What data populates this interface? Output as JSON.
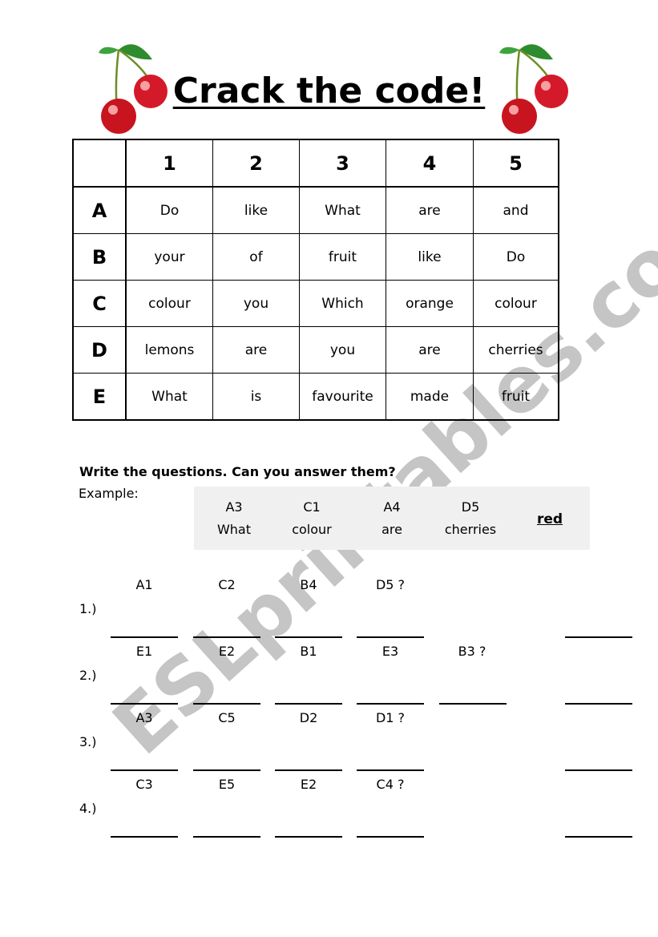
{
  "title": "Crack the code!",
  "watermark": "ESLprintables.com",
  "grid": {
    "columns": [
      "1",
      "2",
      "3",
      "4",
      "5"
    ],
    "rows": [
      {
        "label": "A",
        "cells": [
          "Do",
          "like",
          "What",
          "are",
          "and"
        ]
      },
      {
        "label": "B",
        "cells": [
          "your",
          "of",
          "fruit",
          "like",
          "Do"
        ]
      },
      {
        "label": "C",
        "cells": [
          "colour",
          "you",
          "Which",
          "orange",
          "colour"
        ]
      },
      {
        "label": "D",
        "cells": [
          "lemons",
          "are",
          "you",
          "are",
          "cherries"
        ]
      },
      {
        "label": "E",
        "cells": [
          "What",
          "is",
          "favourite",
          "made",
          "fruit"
        ]
      }
    ]
  },
  "instructions": "Write the questions. Can you answer them?",
  "example": {
    "label": "Example:",
    "codes": [
      "A3",
      "C1",
      "A4",
      "D5"
    ],
    "words": [
      "What",
      "colour",
      "are",
      "cherries"
    ],
    "answer": "red"
  },
  "questions": [
    {
      "number": "1.)",
      "codes": [
        "A1",
        "C2",
        "B4",
        "D5 ?"
      ]
    },
    {
      "number": "2.)",
      "codes": [
        "E1",
        "E2",
        "B1",
        "E3",
        "B3 ?"
      ]
    },
    {
      "number": "3.)",
      "codes": [
        "A3",
        "C5",
        "D2",
        "D1 ?"
      ]
    },
    {
      "number": "4.)",
      "codes": [
        "C3",
        "E5",
        "E2",
        "C4 ?"
      ]
    }
  ],
  "colors": {
    "cherry": "#d41a2a",
    "leaf": "#2e8b2e",
    "example_bg": "#f0f0f0",
    "watermark": "#969696"
  }
}
